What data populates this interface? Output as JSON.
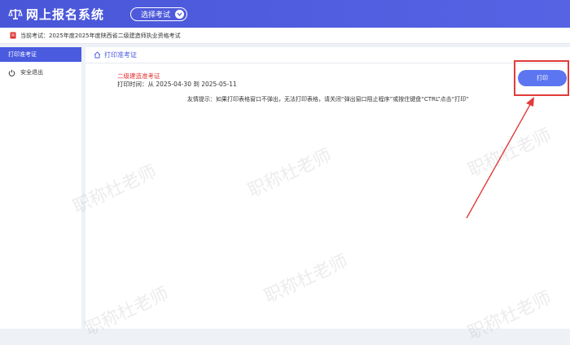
{
  "header": {
    "title": "网上报名系统",
    "select_exam_label": "选择考试"
  },
  "notice": {
    "text": "当前考试：2025年度2025年度陕西省二级建造师执业资格考试"
  },
  "sidebar": {
    "items": [
      {
        "label": "打印准考证",
        "active": true
      },
      {
        "label": "安全退出",
        "active": false
      }
    ]
  },
  "main": {
    "section_title": "打印准考证",
    "cert_name": "二级建造准考证",
    "print_time": "打印时间：从 2025-04-30 到 2025-05-11",
    "tip": "友情提示：如果打印表格窗口不弹出，无法打印表格，请关闭“弹出窗口阻止程序”或按住键盘“CTRL”点击“打印”",
    "print_button": "打印"
  },
  "watermark": {
    "text": "职称杜老师"
  },
  "colors": {
    "primary": "#4a5be0",
    "alert": "#e23b3b"
  }
}
